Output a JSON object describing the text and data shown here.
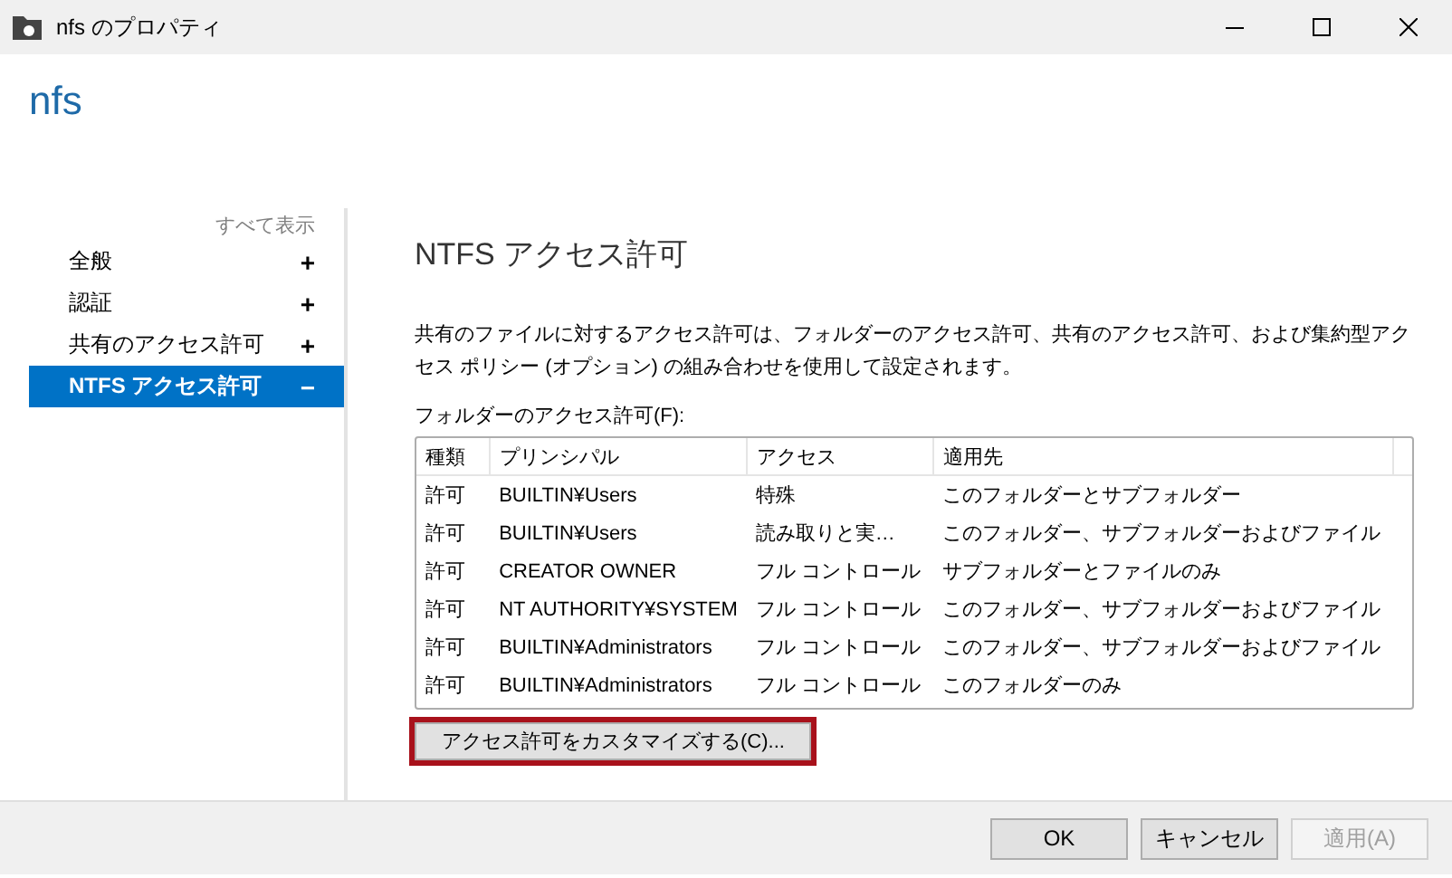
{
  "window": {
    "title": "nfs のプロパティ"
  },
  "heading": "nfs",
  "sidebar": {
    "show_all": "すべて表示",
    "items": [
      {
        "label": "全般",
        "toggle": "+",
        "selected": false
      },
      {
        "label": "認証",
        "toggle": "+",
        "selected": false
      },
      {
        "label": "共有のアクセス許可",
        "toggle": "+",
        "selected": false
      },
      {
        "label": "NTFS アクセス許可",
        "toggle": "−",
        "selected": true
      }
    ]
  },
  "section": {
    "title": "NTFS アクセス許可",
    "description": "共有のファイルに対するアクセス許可は、フォルダーのアクセス許可、共有のアクセス許可、および集約型アクセス ポリシー (オプション) の組み合わせを使用して設定されます。",
    "table_label": "フォルダーのアクセス許可(F):",
    "table": {
      "columns": [
        "種類",
        "プリンシパル",
        "アクセス",
        "適用先"
      ],
      "rows": [
        [
          "許可",
          "BUILTIN¥Users",
          "特殊",
          "このフォルダーとサブフォルダー"
        ],
        [
          "許可",
          "BUILTIN¥Users",
          "読み取りと実…",
          "このフォルダー、サブフォルダーおよびファイル"
        ],
        [
          "許可",
          "CREATOR OWNER",
          "フル コントロール",
          "サブフォルダーとファイルのみ"
        ],
        [
          "許可",
          "NT AUTHORITY¥SYSTEM",
          "フル コントロール",
          "このフォルダー、サブフォルダーおよびファイル"
        ],
        [
          "許可",
          "BUILTIN¥Administrators",
          "フル コントロール",
          "このフォルダー、サブフォルダーおよびファイル"
        ],
        [
          "許可",
          "BUILTIN¥Administrators",
          "フル コントロール",
          "このフォルダーのみ"
        ]
      ]
    },
    "customize_button": {
      "label": "アクセス許可をカスタマイズする(C)...",
      "highlighted": true
    }
  },
  "buttons": [
    {
      "label": "OK",
      "disabled": false
    },
    {
      "label": "キャンセル",
      "disabled": false
    },
    {
      "label": "適用(A)",
      "disabled": true
    }
  ]
}
